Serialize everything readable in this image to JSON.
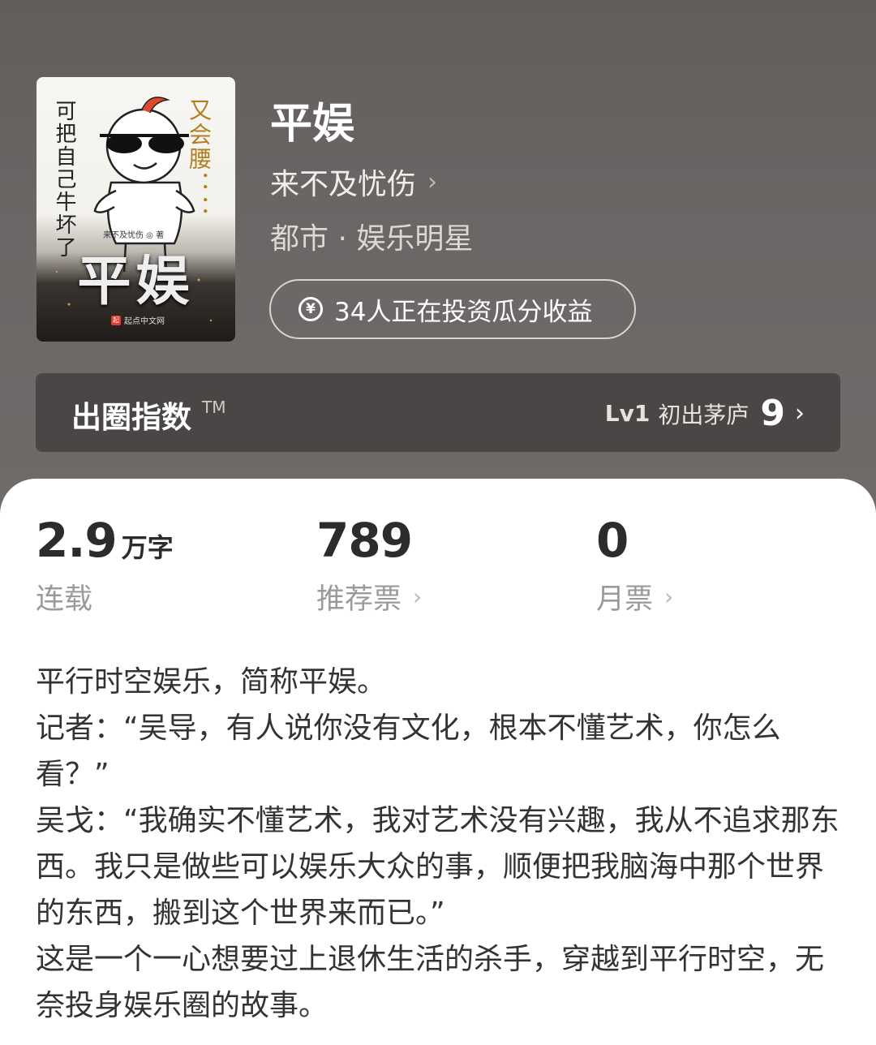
{
  "cover": {
    "vertical_left": "可把自己牛坏了",
    "vertical_right": "又会腰：：",
    "author_tag": "来不及忧伤 ◎ 著",
    "title": "平娱",
    "publisher": "起点中文网"
  },
  "book": {
    "title": "平娱",
    "author": "来不及忧伤",
    "category": "都市 · 娱乐明星",
    "invest_text": "34人正在投资瓜分收益"
  },
  "index_bar": {
    "label": "出圈指数",
    "tm": "TM",
    "level": "Lv1",
    "level_name": "初出茅庐",
    "score": "9"
  },
  "stats": [
    {
      "value": "2.9",
      "unit": "万字",
      "label": "连载"
    },
    {
      "value": "789",
      "label": "推荐票"
    },
    {
      "value": "0",
      "label": "月票"
    }
  ],
  "description": [
    "平行时空娱乐，简称平娱。",
    "记者：“吴导，有人说你没有文化，根本不懂艺术，你怎么看？”",
    "吴戈：“我确实不懂艺术，我对艺术没有兴趣，我从不追求那东西。我只是做些可以娱乐大众的事，顺便把我脑海中那个世界的东西，搬到这个世界来而已。”",
    "这是一个一心想要过上退休生活的杀手，穿越到平行时空，无奈投身娱乐圈的故事。"
  ]
}
